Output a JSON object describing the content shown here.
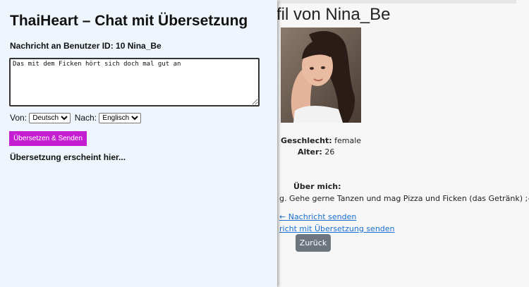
{
  "profile": {
    "title": "fil von Nina_Be",
    "gender_label": "Geschlecht:",
    "gender_value": "female",
    "age_label": "Alter:",
    "age_value": "26",
    "about_label": "Über mich:",
    "about_text": "g. Gehe gerne Tanzen und mag Pizza und Ficken (das Getränk) ;-)",
    "send_link": "← Nachricht senden",
    "translate_link": "richt mit Übersetzung senden",
    "back_label": "Zurück"
  },
  "panel": {
    "title": "ThaiHeart – Chat mit Übersetzung",
    "recipient": "Nachricht an Benutzer ID: 10 Nina_Be",
    "message": "Das mit dem Ficken hört sich doch mal gut an",
    "from_label": "Von:",
    "from_value": "Deutsch",
    "to_label": "Nach:",
    "to_value": "Englisch",
    "send_label": "Übersetzen & Senden",
    "result_text": "Übersetzung erscheint hier..."
  },
  "colors": {
    "send_button": "#c51dd1",
    "back_button": "#6c757d",
    "link": "#1a6fd0",
    "panel_bg": "#eef5fc"
  }
}
